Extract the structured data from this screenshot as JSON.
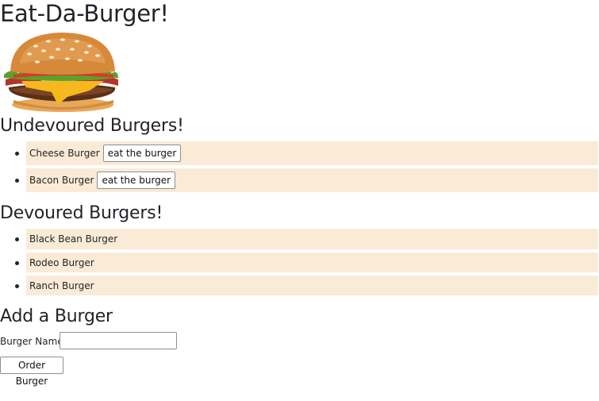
{
  "header": {
    "title": "Eat-Da-Burger!"
  },
  "image": {
    "icon": "burger-image"
  },
  "undevoured": {
    "heading": "Undevoured Burgers!",
    "button_label": "eat the burger",
    "items": [
      {
        "name": "Cheese Burger"
      },
      {
        "name": "Bacon Burger"
      }
    ]
  },
  "devoured": {
    "heading": "Devoured Burgers!",
    "items": [
      {
        "name": "Black Bean Burger"
      },
      {
        "name": "Rodeo Burger"
      },
      {
        "name": "Ranch Burger"
      }
    ]
  },
  "add_form": {
    "heading": "Add a Burger",
    "name_label": "Burger Name:",
    "name_value": "",
    "submit_label": "Order Burger"
  },
  "colors": {
    "row_background": "#faebd7",
    "text": "#212529"
  }
}
